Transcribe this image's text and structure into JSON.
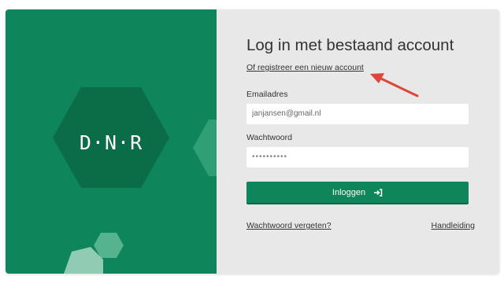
{
  "brand": {
    "logo_text": "D·N·R"
  },
  "login": {
    "title": "Log in met bestaand account",
    "register_link": "Of registreer een nieuw account",
    "email_label": "Emailadres",
    "email_value": "janjansen@gmail.nl",
    "password_label": "Wachtwoord",
    "password_value": "••••••••••",
    "submit_label": "Inloggen",
    "forgot_link": "Wachtwoord vergeten?",
    "manual_link": "Handleiding"
  },
  "colors": {
    "brand_green": "#0e855a",
    "panel_gray": "#e8e8e8",
    "annotation_red": "#e0453a"
  },
  "icons": {
    "submit_icon": "sign-in-icon",
    "annotation": "red-arrow-annotation"
  }
}
